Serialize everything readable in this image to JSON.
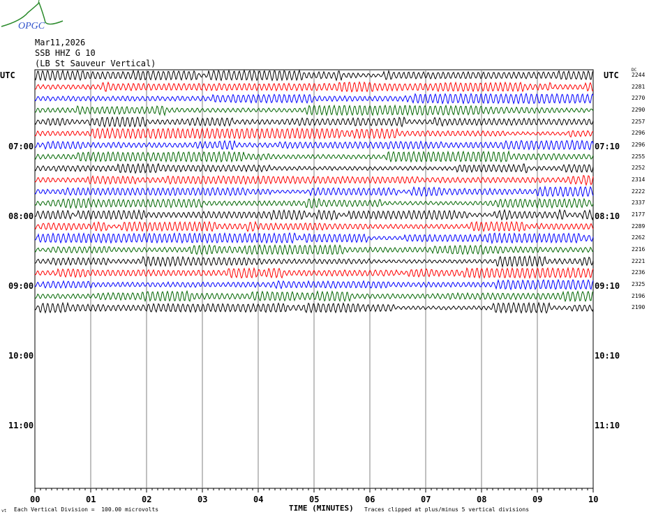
{
  "logo_text": "OPGC",
  "header": {
    "date": "Mar11,2026",
    "station": "SSB HHZ G 10",
    "location": "(LB  St Sauveur Vertical)"
  },
  "left_labels": [
    "UTC",
    "07:00",
    "08:00",
    "09:00",
    "10:00",
    "11:00"
  ],
  "right_labels": [
    "UTC",
    "07:10",
    "08:10",
    "09:10",
    "10:10",
    "11:10"
  ],
  "dc_header": "DC",
  "footer": {
    "scale": "Each Vertical Division =  100.00 microvolts",
    "xlabel": "TIME (MINUTES)",
    "clip": "Traces clipped at plus/minus 5 vertical divisions",
    "corner": "vt"
  },
  "colors": {
    "trace_cycle": [
      "#000000",
      "#ff0000",
      "#0000ff",
      "#006600"
    ],
    "grid": "#808080"
  },
  "chart_data": {
    "type": "line",
    "title": "SSB HHZ G 10 helicorder",
    "xlabel": "TIME (MINUTES)",
    "x_ticks": [
      "00",
      "01",
      "02",
      "03",
      "04",
      "05",
      "06",
      "07",
      "08",
      "09",
      "10"
    ],
    "xlim": [
      0,
      10
    ],
    "rows_per_hour": 6,
    "total_rows": 36,
    "traces_dc": [
      2244,
      2281,
      2270,
      2290,
      2257,
      2296,
      2296,
      2255,
      2252,
      2314,
      2222,
      2337,
      2177,
      2289,
      2262,
      2216,
      2221,
      2236,
      2325,
      2196,
      2190
    ]
  }
}
